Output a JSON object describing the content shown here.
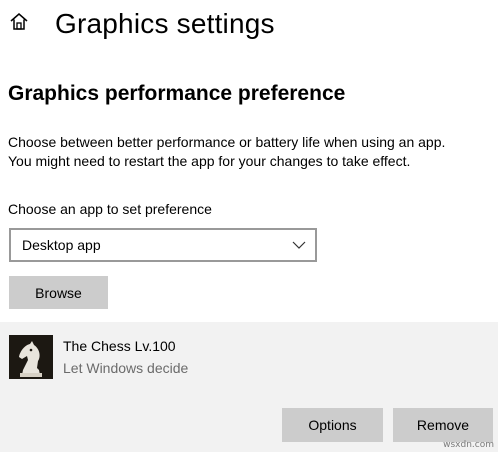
{
  "header": {
    "title": "Graphics settings",
    "home_icon": "home-icon"
  },
  "section": {
    "title": "Graphics performance preference",
    "description_line1": "Choose between better performance or battery life when using an app.",
    "description_line2": "You might need to restart the app for your changes to take effect."
  },
  "app_selector": {
    "label": "Choose an app to set preference",
    "selected": "Desktop app",
    "chevron_icon": "chevron-down-icon",
    "browse_label": "Browse"
  },
  "app_entry": {
    "name": "The Chess Lv.100",
    "preference": "Let Windows decide",
    "icon": "chess-knight-icon",
    "options_label": "Options",
    "remove_label": "Remove"
  },
  "watermark": "wsxdn.com",
  "colors": {
    "button_bg": "#cccccc",
    "panel_bg": "#f2f2f2",
    "select_border": "#999999",
    "secondary_text": "#6b6b6b"
  }
}
